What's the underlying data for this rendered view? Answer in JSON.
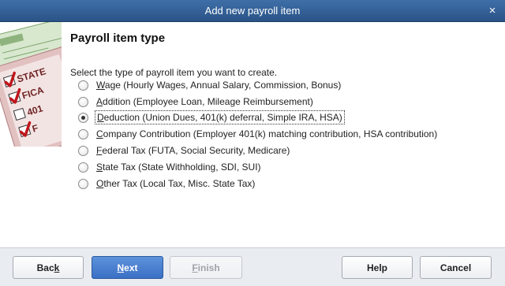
{
  "window": {
    "title": "Add new payroll item",
    "close_glyph": "×"
  },
  "art": {
    "check_labels": [
      "STATE",
      "FICA",
      "401",
      "F"
    ]
  },
  "main": {
    "heading": "Payroll item type",
    "instruction": "Select the type of payroll item you want to create.",
    "options": [
      {
        "mnemonic": "W",
        "rest": "age (Hourly Wages, Annual Salary, Commission, Bonus)",
        "checked": false
      },
      {
        "mnemonic": "A",
        "rest": "ddition (Employee Loan, Mileage Reimbursement)",
        "checked": false
      },
      {
        "mnemonic": "D",
        "rest": "eduction (Union Dues, 401(k) deferral, Simple IRA, HSA)",
        "checked": true
      },
      {
        "mnemonic": "C",
        "rest": "ompany Contribution (Employer 401(k) matching contribution, HSA contribution)",
        "checked": false
      },
      {
        "mnemonic": "F",
        "rest": "ederal Tax (FUTA, Social Security, Medicare)",
        "checked": false
      },
      {
        "mnemonic": "S",
        "rest": "tate Tax (State Withholding, SDI, SUI)",
        "checked": false
      },
      {
        "mnemonic": "O",
        "rest": "ther Tax (Local Tax, Misc. State Tax)",
        "checked": false
      }
    ]
  },
  "footer": {
    "back": {
      "pre": "Bac",
      "mnemonic": "k",
      "post": ""
    },
    "next": {
      "pre": "",
      "mnemonic": "N",
      "post": "ext"
    },
    "finish": {
      "pre": "",
      "mnemonic": "F",
      "post": "inish"
    },
    "help_label": "Help",
    "cancel_label": "Cancel"
  }
}
